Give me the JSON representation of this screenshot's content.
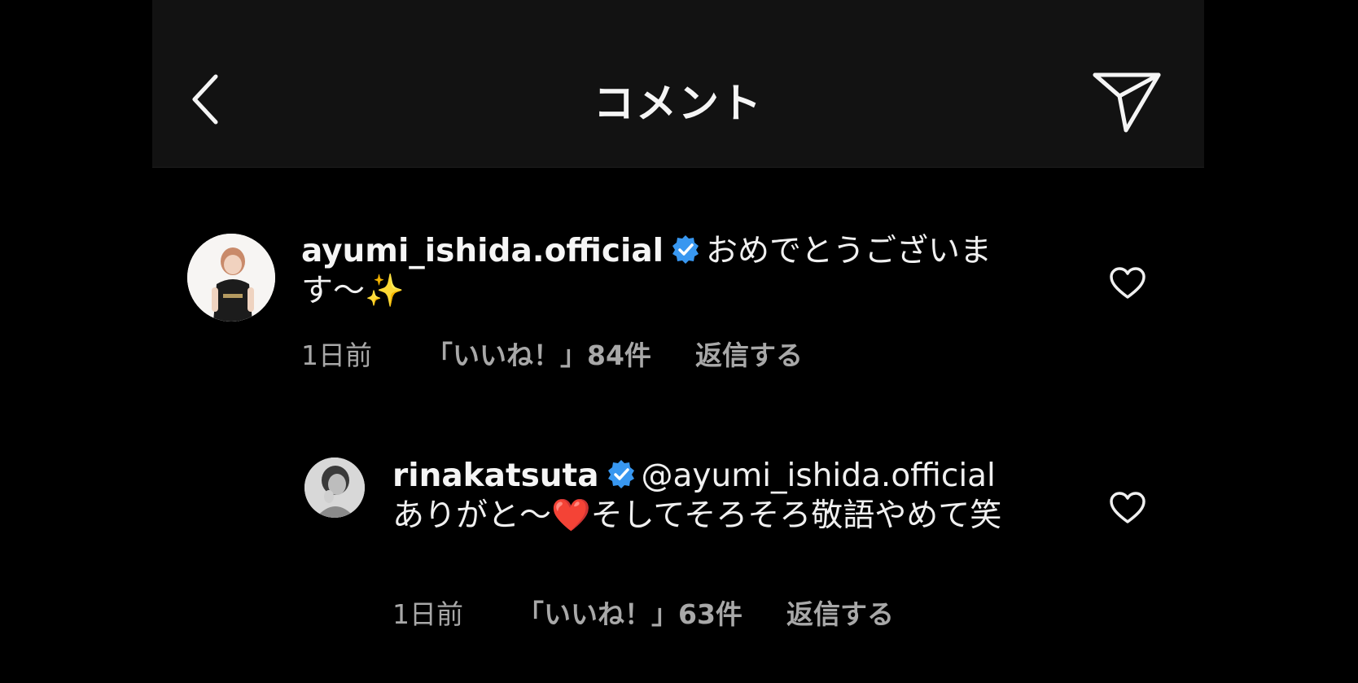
{
  "header": {
    "title": "コメント",
    "back_icon": "chevron-left-icon",
    "send_icon": "paper-plane-icon"
  },
  "comments": [
    {
      "username": "ayumi_ishida.official",
      "verified": true,
      "text": "おめでとうございます〜",
      "emoji": "✨",
      "time": "1日前",
      "likes": "「いいね！」84件",
      "reply": "返信する"
    },
    {
      "username": "rinakatsuta",
      "verified": true,
      "mention": "@ayumi_ishida.official",
      "text_before_emoji": "ありがと〜",
      "emoji": "❤️",
      "text_after_emoji": "そしてそろそろ敬語やめて笑",
      "time": "1日前",
      "likes": "「いいね！」63件",
      "reply": "返信する"
    }
  ],
  "colors": {
    "background": "#000000",
    "header_bg": "#121212",
    "text": "#f0f0f0",
    "meta_text": "#a8a8a8",
    "verified_badge": "#3897f0"
  }
}
